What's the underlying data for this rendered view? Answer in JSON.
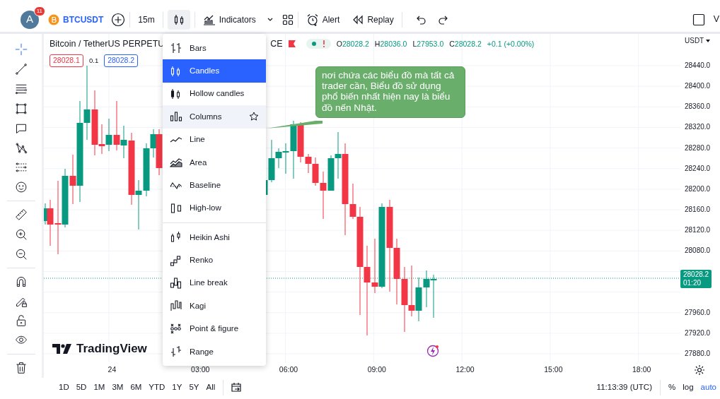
{
  "top_toolbar": {
    "avatar": {
      "letter": "A",
      "badge": "11"
    },
    "symbol": "BTCUSDT",
    "interval": "15m",
    "chart_type_menu_open": true,
    "indicators": "Indicators",
    "alert": "Alert",
    "replay": "Replay",
    "cut_label": "V"
  },
  "legend": {
    "title": "Bitcoin / TetherUS PERPETU",
    "title_end": "CE",
    "ohlc": [
      {
        "prefix": "O",
        "value": "28028.2"
      },
      {
        "prefix": "H",
        "value": "28036.0"
      },
      {
        "prefix": "L",
        "value": "27953.0"
      },
      {
        "prefix": "C",
        "value": "28028.2"
      }
    ],
    "change": "+0.1 (+0.00%)",
    "sell": "28028.1",
    "spread": "0.1",
    "buy": "28028.2"
  },
  "currency": "USDT",
  "price_axis_upper": [
    "28440.0",
    "28400.0",
    "28360.0",
    "28320.0",
    "28280.0",
    "28240.0",
    "28200.0",
    "28160.0",
    "28120.0",
    "28080.0"
  ],
  "price_axis_lower": [
    "27960.0",
    "27920.0",
    "27880.0"
  ],
  "last_price": {
    "price": "28028.2",
    "countdown": "01:20"
  },
  "time_axis": [
    "24",
    "03:00",
    "06:00",
    "09:00",
    "12:00",
    "15:00",
    "18:00"
  ],
  "logo": "TradingView",
  "chart_type_menu": {
    "groups": [
      {
        "items": [
          {
            "kind": "bars",
            "label": "Bars",
            "selected": false,
            "hovered": false
          },
          {
            "kind": "candles",
            "label": "Candles",
            "selected": true,
            "hovered": false
          },
          {
            "kind": "hollow_candles",
            "label": "Hollow candles",
            "selected": false,
            "hovered": false
          },
          {
            "kind": "columns",
            "label": "Columns",
            "selected": false,
            "hovered": true
          },
          {
            "kind": "line",
            "label": "Line",
            "selected": false,
            "hovered": false
          },
          {
            "kind": "area",
            "label": "Area",
            "selected": false,
            "hovered": false
          },
          {
            "kind": "baseline",
            "label": "Baseline",
            "selected": false,
            "hovered": false
          },
          {
            "kind": "high_low",
            "label": "High-low",
            "selected": false,
            "hovered": false
          }
        ]
      },
      {
        "items": [
          {
            "kind": "heikin_ashi",
            "label": "Heikin Ashi",
            "selected": false,
            "hovered": false
          },
          {
            "kind": "renko",
            "label": "Renko",
            "selected": false,
            "hovered": false
          },
          {
            "kind": "line_break",
            "label": "Line break",
            "selected": false,
            "hovered": false
          },
          {
            "kind": "kagi",
            "label": "Kagi",
            "selected": false,
            "hovered": false
          },
          {
            "kind": "point_figure",
            "label": "Point & figure",
            "selected": false,
            "hovered": false
          },
          {
            "kind": "range",
            "label": "Range",
            "selected": false,
            "hovered": false
          }
        ]
      }
    ]
  },
  "callout": {
    "text": "nơi chứa các biểu đồ mà tất cả trader cần, Biểu đồ sử dụng phổ biến nhất hiện nay là biểu đồ nến Nhật."
  },
  "bottom_bar": {
    "ranges": [
      "1D",
      "5D",
      "1M",
      "3M",
      "6M",
      "YTD",
      "1Y",
      "5Y",
      "All"
    ],
    "clock": "11:13:39 (UTC)",
    "scale_modes": [
      {
        "label": "%",
        "selected": false
      },
      {
        "label": "log",
        "selected": false
      },
      {
        "label": "auto",
        "selected": true
      }
    ]
  }
}
